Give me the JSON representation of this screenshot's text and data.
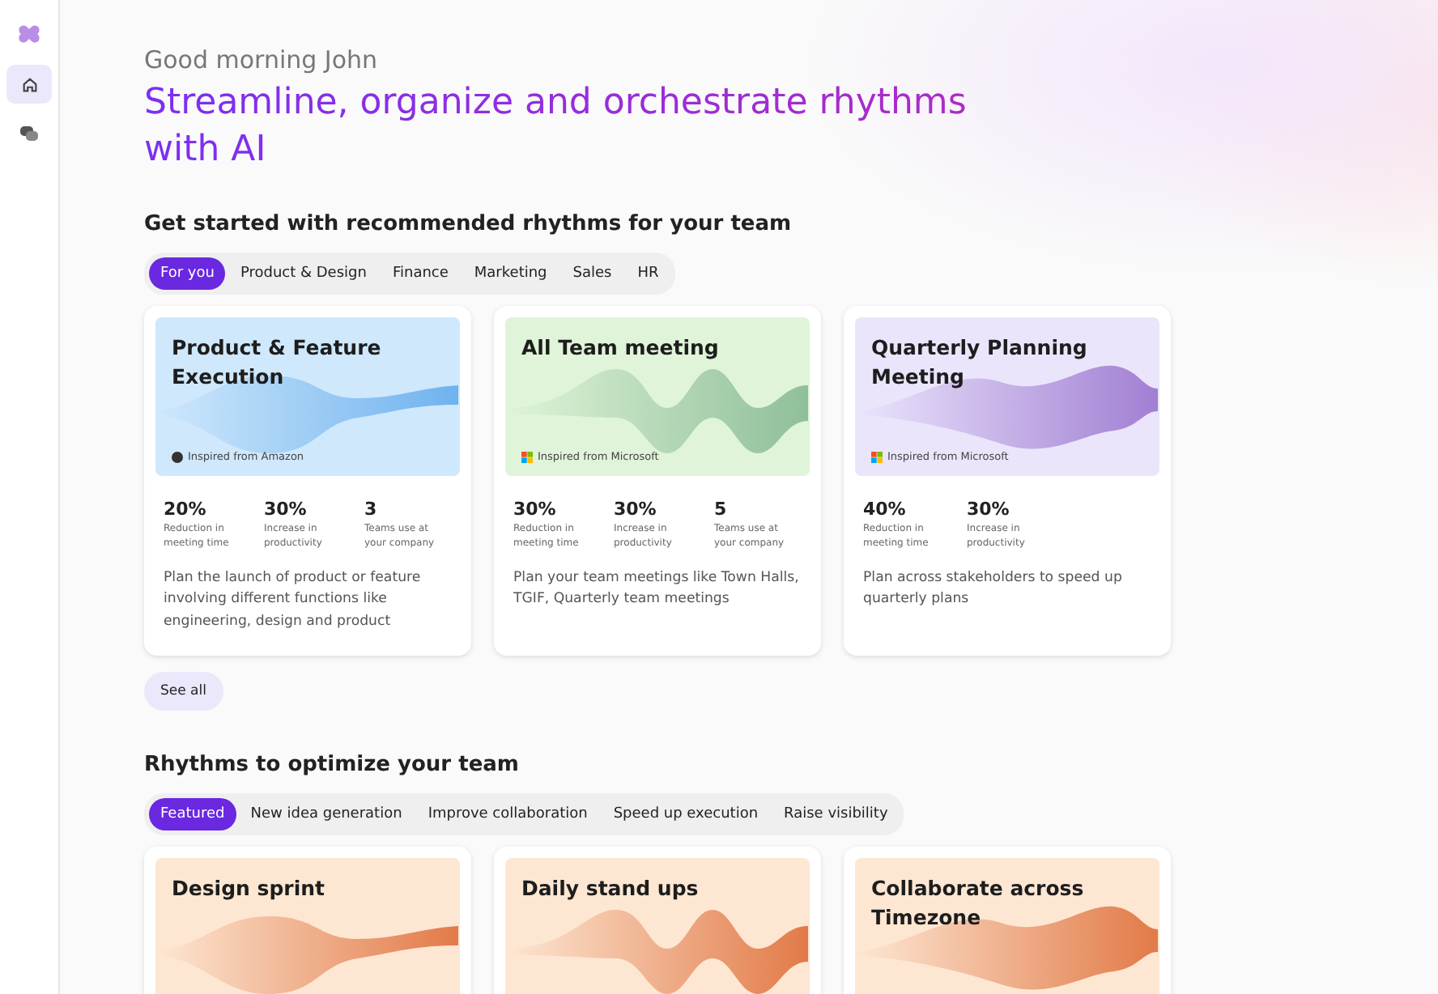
{
  "sidebar": {
    "items": [
      {
        "kind": "home",
        "selected": true
      },
      {
        "kind": "chat",
        "selected": false
      }
    ]
  },
  "greeting": "Good morning John",
  "headline": "Streamline, organize and orchestrate rhythms with AI",
  "recommended": {
    "title": "Get started with recommended rhythms for your team",
    "tabs": [
      {
        "label": "For you",
        "selected": true
      },
      {
        "label": "Product & Design",
        "selected": false
      },
      {
        "label": "Finance",
        "selected": false
      },
      {
        "label": "Marketing",
        "selected": false
      },
      {
        "label": "Sales",
        "selected": false
      },
      {
        "label": "HR",
        "selected": false
      }
    ],
    "cards": [
      {
        "title": "Product & Feature Execution",
        "color": "#cfe8fc",
        "source": {
          "kind": "circle",
          "text": "Inspired from Amazon"
        },
        "stats": [
          {
            "value": "20%",
            "label": "Reduction in meeting time"
          },
          {
            "value": "30%",
            "label": "Increase in productivity"
          },
          {
            "value": "3",
            "label": "Teams use at your company"
          }
        ],
        "description": "Plan the launch of product or feature involving different functions like engineering, design and product"
      },
      {
        "title": "All Team meeting",
        "color": "#dff4d8",
        "source": {
          "kind": "squares",
          "text": "Inspired from Microsoft"
        },
        "stats": [
          {
            "value": "30%",
            "label": "Reduction in meeting time"
          },
          {
            "value": "30%",
            "label": "Increase in productivity"
          },
          {
            "value": "5",
            "label": "Teams use at your company"
          }
        ],
        "description": "Plan your team meetings like Town Halls, TGIF, Quarterly team meetings"
      },
      {
        "title": "Quarterly Planning Meeting",
        "color": "#ebe5fc",
        "source": {
          "kind": "squares",
          "text": "Inspired from Microsoft"
        },
        "stats": [
          {
            "value": "40%",
            "label": "Reduction in meeting time"
          },
          {
            "value": "30%",
            "label": "Increase in productivity"
          }
        ],
        "description": "Plan across stakeholders to speed up quarterly plans"
      }
    ],
    "see_all": "See all"
  },
  "optimize": {
    "title": "Rhythms to optimize your team",
    "tabs": [
      {
        "label": "Featured",
        "selected": true
      },
      {
        "label": "New idea generation",
        "selected": false
      },
      {
        "label": "Improve collaboration",
        "selected": false
      },
      {
        "label": "Speed up execution",
        "selected": false
      },
      {
        "label": "Raise visibility",
        "selected": false
      }
    ],
    "cards": [
      {
        "title": "Design sprint",
        "color": "#fde7d3"
      },
      {
        "title": "Daily stand ups",
        "color": "#fde7d3"
      },
      {
        "title": "Collaborate across Timezone",
        "color": "#fde7d3"
      }
    ]
  }
}
